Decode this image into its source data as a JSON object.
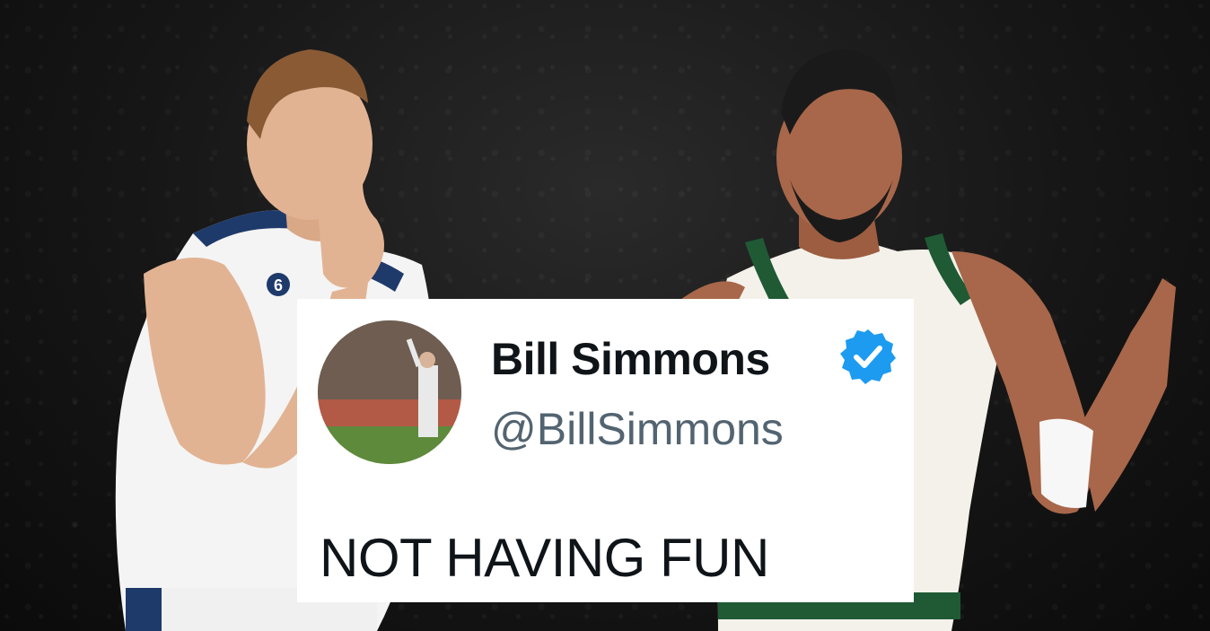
{
  "tweet_card": {
    "display_name": "Bill Simmons",
    "handle": "@BillSimmons",
    "verified_icon": "verified-badge-icon",
    "text": "NOT HAVING FUN",
    "colors": {
      "name": "#0f1419",
      "handle": "#536471",
      "badge": "#1d9bf0",
      "card_bg": "#ffffff"
    }
  },
  "background": {
    "left_player_jersey_number": "6",
    "colors": {
      "arena": "#161616",
      "left_jersey": "#ffffff",
      "left_trim": "#1e3a6b",
      "right_jersey": "#f4f1ea",
      "right_trim": "#1f5a35"
    }
  }
}
